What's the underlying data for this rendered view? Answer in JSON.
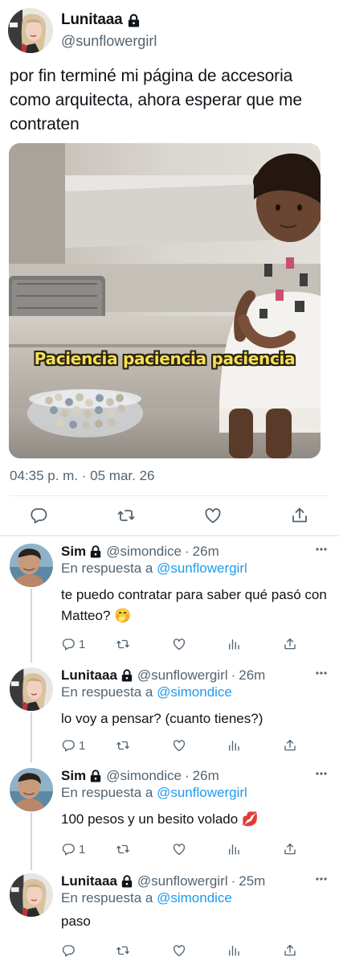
{
  "main_tweet": {
    "author": {
      "display_name": "Lunitaaa",
      "handle": "@sunflowergirl",
      "protected": true
    },
    "text": "por fin terminé mi página de accesoria como arquitecta, ahora esperar que me contraten",
    "media": {
      "caption": "Paciencia paciencia paciencia"
    },
    "timestamp": "04:35 p. m. · 05 mar. 26",
    "actions": [
      "reply-icon",
      "retweet-icon",
      "like-icon",
      "share-icon"
    ]
  },
  "replies": [
    {
      "display_name": "Sim",
      "handle": "@simondice",
      "separator": "·",
      "time": "26m",
      "reply_prefix": "En respuesta a",
      "reply_to": "@sunflowergirl",
      "text": "te puedo contratar para saber qué pasó con Matteo? 🤭",
      "reply_count": "1"
    },
    {
      "display_name": "Lunitaaa",
      "handle": "@sunflowergirl",
      "separator": "·",
      "time": "26m",
      "reply_prefix": "En respuesta a",
      "reply_to": "@simondice",
      "text": "lo voy a pensar? (cuanto tienes?)",
      "reply_count": "1"
    },
    {
      "display_name": "Sim",
      "handle": "@simondice",
      "separator": "·",
      "time": "26m",
      "reply_prefix": "En respuesta a",
      "reply_to": "@sunflowergirl",
      "text": "100 pesos y un besito volado 💋",
      "reply_count": "1"
    },
    {
      "display_name": "Lunitaaa",
      "handle": "@sunflowergirl",
      "separator": "·",
      "time": "25m",
      "reply_prefix": "En respuesta a",
      "reply_to": "@simondice",
      "text": "paso",
      "reply_count": ""
    }
  ],
  "colors": {
    "text": "#0f1419",
    "secondary": "#536471",
    "link": "#1d9bf0",
    "divider": "#e6ecf0",
    "caption": "#f5df57"
  }
}
